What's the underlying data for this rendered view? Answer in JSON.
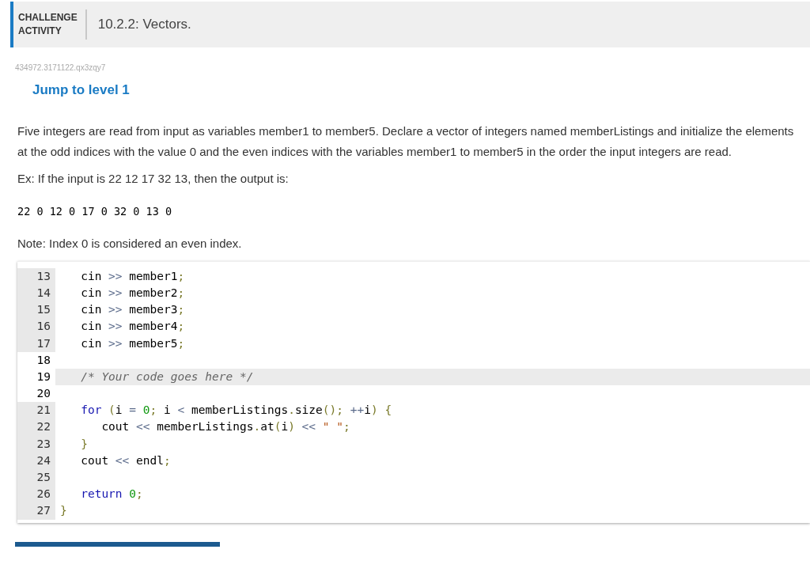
{
  "header": {
    "badge_line_1": "CHALLENGE",
    "badge_line_2": "ACTIVITY",
    "title": "10.2.2: Vectors."
  },
  "activity_id": "434972.3171122.qx3zqy7",
  "level_link": "Jump to level 1",
  "instructions": "Five integers are read from input as variables member1 to member5. Declare a vector of integers named memberListings and initialize the elements at the odd indices with the value 0 and the even indices with the variables member1 to member5 in the order the input integers are read.",
  "example_intro": "Ex: If the input is 22 12 17 32 13, then the output is:",
  "example_output": "22 0 12 0 17 0 32 0 13 0",
  "note": "Note: Index 0 is considered an even index.",
  "editor": {
    "lines": [
      {
        "number": "13",
        "read_only": true,
        "active": false,
        "tokens": [
          {
            "kind": "plain",
            "text": "   cin "
          },
          {
            "kind": "op",
            "text": ">>"
          },
          {
            "kind": "plain",
            "text": " member1"
          },
          {
            "kind": "punct",
            "text": ";"
          }
        ]
      },
      {
        "number": "14",
        "read_only": true,
        "active": false,
        "tokens": [
          {
            "kind": "plain",
            "text": "   cin "
          },
          {
            "kind": "op",
            "text": ">>"
          },
          {
            "kind": "plain",
            "text": " member2"
          },
          {
            "kind": "punct",
            "text": ";"
          }
        ]
      },
      {
        "number": "15",
        "read_only": true,
        "active": false,
        "tokens": [
          {
            "kind": "plain",
            "text": "   cin "
          },
          {
            "kind": "op",
            "text": ">>"
          },
          {
            "kind": "plain",
            "text": " member3"
          },
          {
            "kind": "punct",
            "text": ";"
          }
        ]
      },
      {
        "number": "16",
        "read_only": true,
        "active": false,
        "tokens": [
          {
            "kind": "plain",
            "text": "   cin "
          },
          {
            "kind": "op",
            "text": ">>"
          },
          {
            "kind": "plain",
            "text": " member4"
          },
          {
            "kind": "punct",
            "text": ";"
          }
        ]
      },
      {
        "number": "17",
        "read_only": true,
        "active": false,
        "tokens": [
          {
            "kind": "plain",
            "text": "   cin "
          },
          {
            "kind": "op",
            "text": ">>"
          },
          {
            "kind": "plain",
            "text": " member5"
          },
          {
            "kind": "punct",
            "text": ";"
          }
        ]
      },
      {
        "number": "18",
        "read_only": false,
        "active": false
      },
      {
        "number": "19",
        "read_only": false,
        "active": true,
        "tokens": [
          {
            "kind": "comment",
            "text": "   /* Your code goes here */"
          }
        ]
      },
      {
        "number": "20",
        "read_only": false,
        "active": false
      },
      {
        "number": "21",
        "read_only": true,
        "active": false,
        "tokens": [
          {
            "kind": "keyword",
            "text": "   for"
          },
          {
            "kind": "punct",
            "text": " ("
          },
          {
            "kind": "plain",
            "text": "i "
          },
          {
            "kind": "op",
            "text": "="
          },
          {
            "kind": "number",
            "text": " 0"
          },
          {
            "kind": "punct",
            "text": ";"
          },
          {
            "kind": "plain",
            "text": " i "
          },
          {
            "kind": "op",
            "text": "<"
          },
          {
            "kind": "plain",
            "text": " memberListings"
          },
          {
            "kind": "punct",
            "text": "."
          },
          {
            "kind": "plain",
            "text": "size"
          },
          {
            "kind": "punct",
            "text": "();"
          },
          {
            "kind": "op",
            "text": " ++"
          },
          {
            "kind": "plain",
            "text": "i"
          },
          {
            "kind": "punct",
            "text": ") {"
          }
        ]
      },
      {
        "number": "22",
        "read_only": true,
        "active": false,
        "tokens": [
          {
            "kind": "plain",
            "text": "      cout "
          },
          {
            "kind": "op",
            "text": "<<"
          },
          {
            "kind": "plain",
            "text": " memberListings"
          },
          {
            "kind": "punct",
            "text": "."
          },
          {
            "kind": "plain",
            "text": "at"
          },
          {
            "kind": "punct",
            "text": "("
          },
          {
            "kind": "plain",
            "text": "i"
          },
          {
            "kind": "punct",
            "text": ")"
          },
          {
            "kind": "op",
            "text": " <<"
          },
          {
            "kind": "string",
            "text": " \" \""
          },
          {
            "kind": "punct",
            "text": ";"
          }
        ]
      },
      {
        "number": "23",
        "read_only": true,
        "active": false,
        "tokens": [
          {
            "kind": "punct",
            "text": "   }"
          }
        ]
      },
      {
        "number": "24",
        "read_only": true,
        "active": false,
        "tokens": [
          {
            "kind": "plain",
            "text": "   cout "
          },
          {
            "kind": "op",
            "text": "<<"
          },
          {
            "kind": "plain",
            "text": " endl"
          },
          {
            "kind": "punct",
            "text": ";"
          }
        ]
      },
      {
        "number": "25",
        "read_only": true,
        "active": false
      },
      {
        "number": "26",
        "read_only": true,
        "active": false,
        "tokens": [
          {
            "kind": "keyword",
            "text": "   return"
          },
          {
            "kind": "number",
            "text": " 0"
          },
          {
            "kind": "punct",
            "text": ";"
          }
        ]
      },
      {
        "number": "27",
        "read_only": true,
        "active": false,
        "tokens": [
          {
            "kind": "punct",
            "text": "}"
          }
        ]
      }
    ]
  }
}
